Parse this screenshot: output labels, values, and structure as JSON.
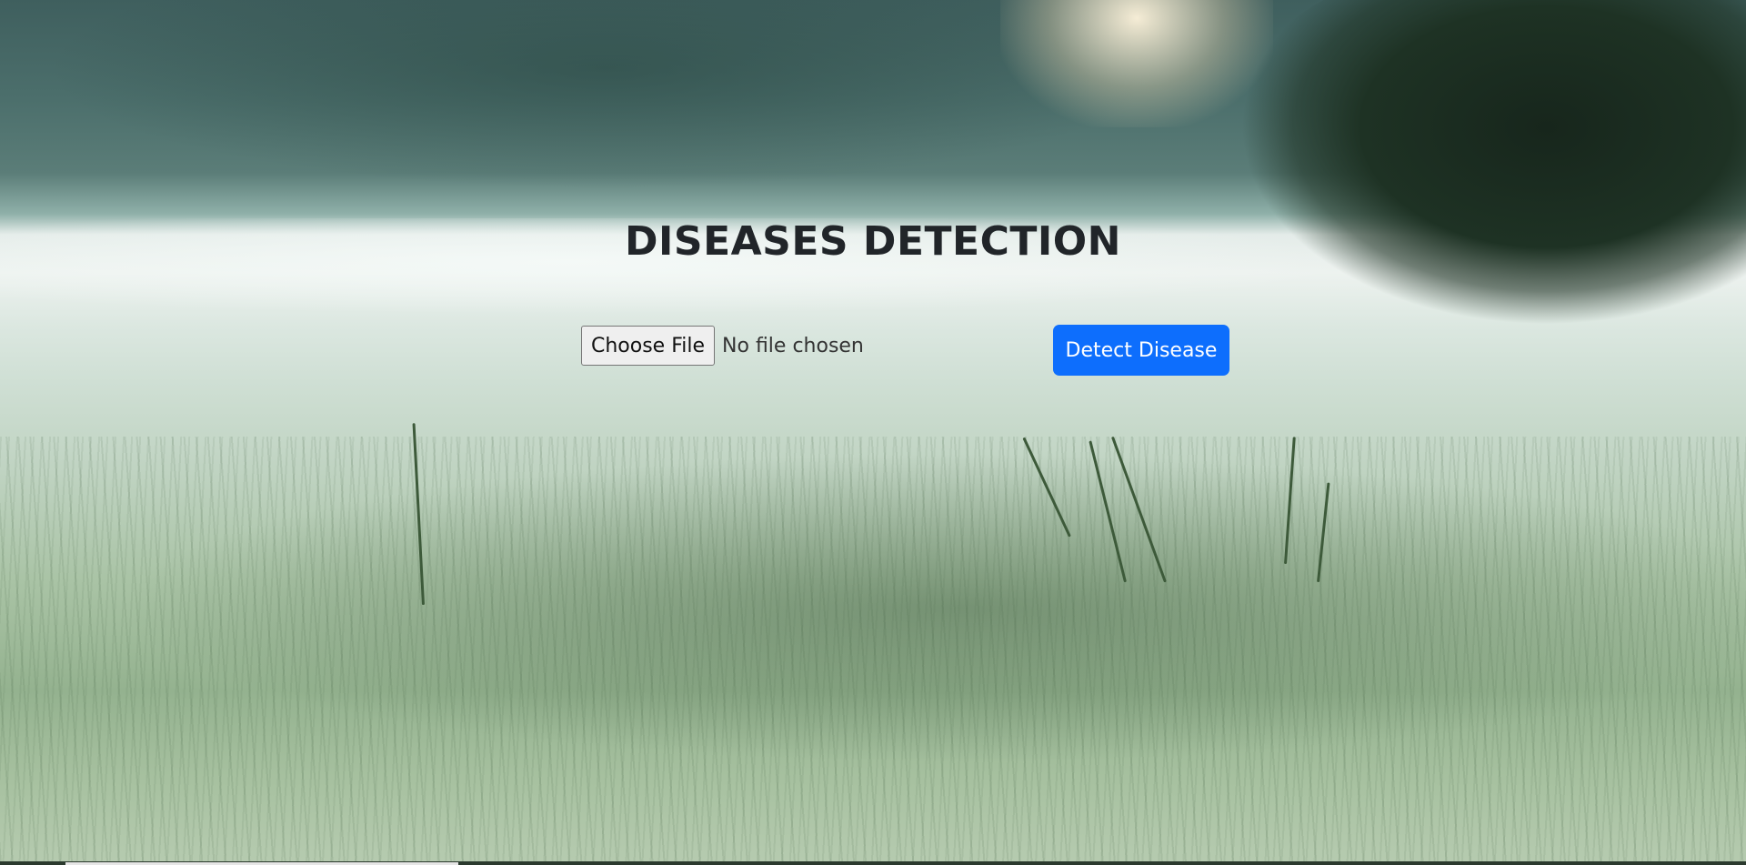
{
  "page": {
    "title": "DISEASES DETECTION"
  },
  "upload": {
    "choose_label": "Choose File",
    "status_text": "No file chosen"
  },
  "actions": {
    "detect_label": "Detect Disease"
  },
  "colors": {
    "accent": "#0d6efd",
    "title_text": "#212529"
  }
}
